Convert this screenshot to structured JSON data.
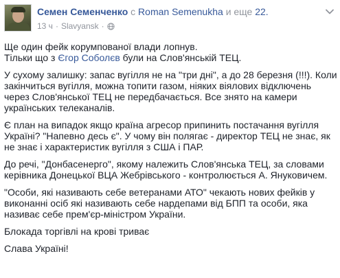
{
  "post": {
    "author": "Семен Семенченко",
    "with_word": "с",
    "tagged_person": "Roman Semenukha",
    "and_more_word": "и еще",
    "others_link": "22.",
    "timestamp": "13 ч",
    "separator": "·",
    "location": "Slavyansk",
    "privacy_icon": "globe-icon",
    "menu_icon": "chevron-down-icon"
  },
  "body": {
    "p1_line1": "Ще один фейк корумпованої влади лопнув.",
    "p1_line2_before": "Тільки що з ",
    "p1_line2_mention": "Єгор Соболєв",
    "p1_line2_after": " були на Слов'янській ТЕЦ.",
    "p2": "У сухому залишку: запас вугілля не на \"три дні\", а до 28 березня (!!!). Коли закінчиться вугілля, можна топити газом, ніяких віялових відключень через Слов'янської ТЕЦ не передбачається. Все знято на камери українських телеканалів.",
    "p3": "Є план на випадок якщо країна агресор припинить постачання вугілля Україні? \"Напевно десь є\". У чому він полягає - директор ТЕЦ не знає, як не знає і характеристик вугілля з США і ПАР.",
    "p4": "До речі, \"Донбасенерго\", якому належить Слов'янська ТЕЦ, за словами керівника Донецької ВЦА Жебрівського - контролюється А. Януковичем.",
    "p5": "\"Особи, які називають себе ветеранами АТО\" чекають нових фейків у виконанні осіб які називають себе нардепами від БПП та особи, яка називає себе прем'єр-міністром України.",
    "p6": "Блокада торгівлі на крові триває",
    "p7": "Слава Україні!"
  },
  "colors": {
    "link": "#365899",
    "text": "#1d2129",
    "meta": "#90949c"
  }
}
